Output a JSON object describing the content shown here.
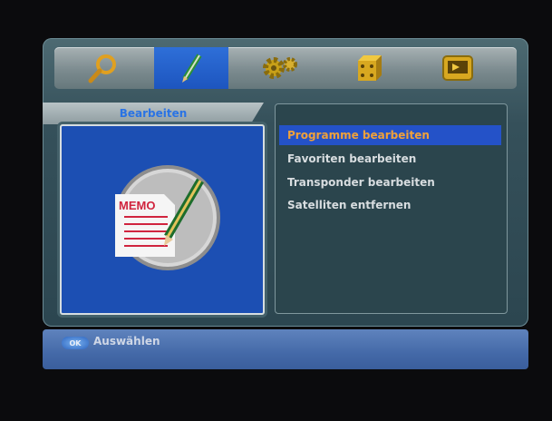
{
  "tabs": [
    {
      "icon": "search-icon"
    },
    {
      "icon": "pencil-icon",
      "active": true
    },
    {
      "icon": "gear-icon"
    },
    {
      "icon": "dice-icon"
    },
    {
      "icon": "monitor-icon"
    }
  ],
  "section": {
    "title": "Bearbeiten"
  },
  "preview": {
    "memo_label": "MEMO"
  },
  "menu": {
    "items": [
      {
        "label": "Programme bearbeiten",
        "selected": true
      },
      {
        "label": "Favoriten bearbeiten"
      },
      {
        "label": "Transponder bearbeiten"
      },
      {
        "label": "Satelliten entfernen"
      }
    ]
  },
  "help": {
    "button": "OK",
    "label": "Auswählen"
  },
  "colors": {
    "accent": "#2452c8",
    "selected_text": "#f0a13a",
    "panel": "#1c4fb3"
  }
}
